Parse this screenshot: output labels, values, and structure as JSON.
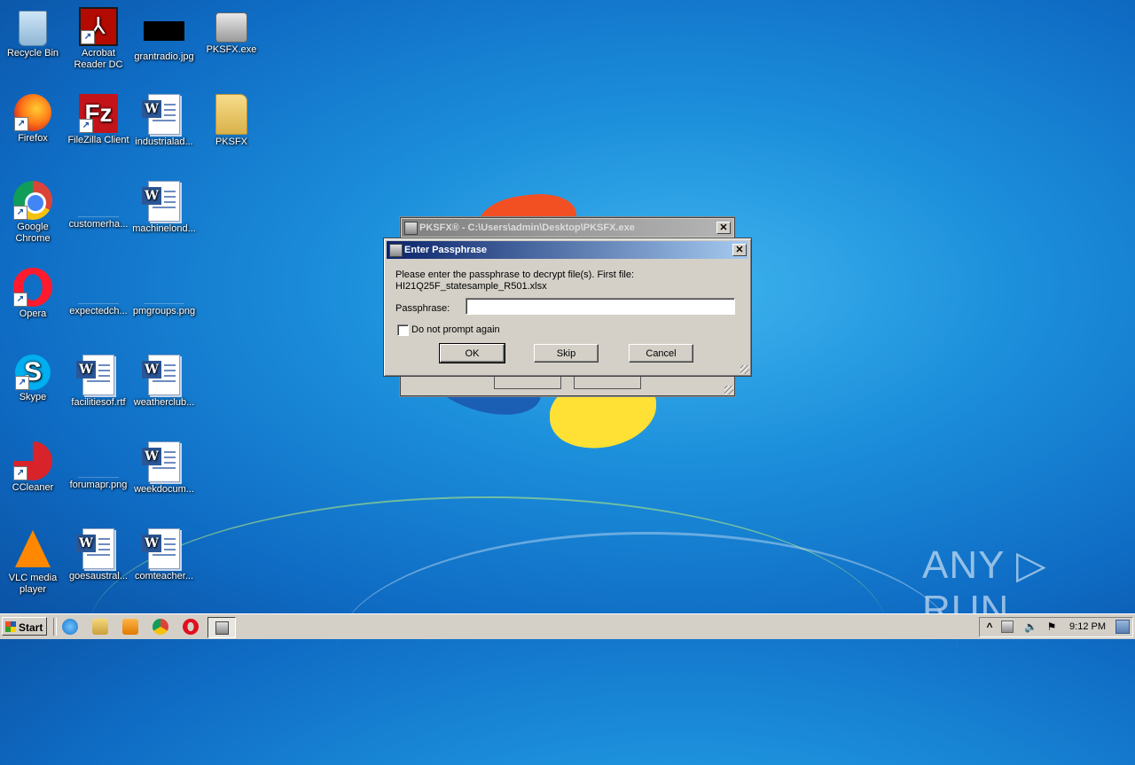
{
  "desktop": {
    "icons": [
      {
        "label": "Recycle Bin"
      },
      {
        "label": "Acrobat Reader DC"
      },
      {
        "label": "grantradio.jpg"
      },
      {
        "label": "PKSFX.exe"
      },
      {
        "label": "Firefox"
      },
      {
        "label": "FileZilla Client"
      },
      {
        "label": "industrialad..."
      },
      {
        "label": "PKSFX"
      },
      {
        "label": "Google Chrome"
      },
      {
        "label": "customerha..."
      },
      {
        "label": "machinelond..."
      },
      {
        "label": "Opera"
      },
      {
        "label": "expectedch..."
      },
      {
        "label": "pmgroups.png"
      },
      {
        "label": "Skype"
      },
      {
        "label": "facilitiesof.rtf"
      },
      {
        "label": "weatherclub..."
      },
      {
        "label": "CCleaner"
      },
      {
        "label": "forumapr.png"
      },
      {
        "label": "weekdocum..."
      },
      {
        "label": "VLC media player"
      },
      {
        "label": "goesaustral..."
      },
      {
        "label": "comteacher..."
      }
    ]
  },
  "background_window": {
    "title": "PKSFX® - C:\\Users\\admin\\Desktop\\PKSFX.exe",
    "close_glyph": "✕"
  },
  "dialog": {
    "title": "Enter Passphrase",
    "close_glyph": "✕",
    "message_line1": "Please enter the passphrase to decrypt file(s). First file:",
    "message_line2": "HI21Q25F_statesample_R501.xlsx",
    "passphrase_label": "Passphrase:",
    "passphrase_value": "",
    "checkbox_label": "Do not prompt again",
    "checkbox_checked": false,
    "ok_label": "OK",
    "skip_label": "Skip",
    "cancel_label": "Cancel"
  },
  "taskbar": {
    "start_label": "Start",
    "clock": "9:12 PM",
    "tray_expand_glyph": "^"
  },
  "watermark": "ANY ▷ RUN",
  "colors": {
    "title_active_start": "#0a246a",
    "title_active_end": "#a6caf0",
    "dialog_face": "#d4d0c8"
  }
}
